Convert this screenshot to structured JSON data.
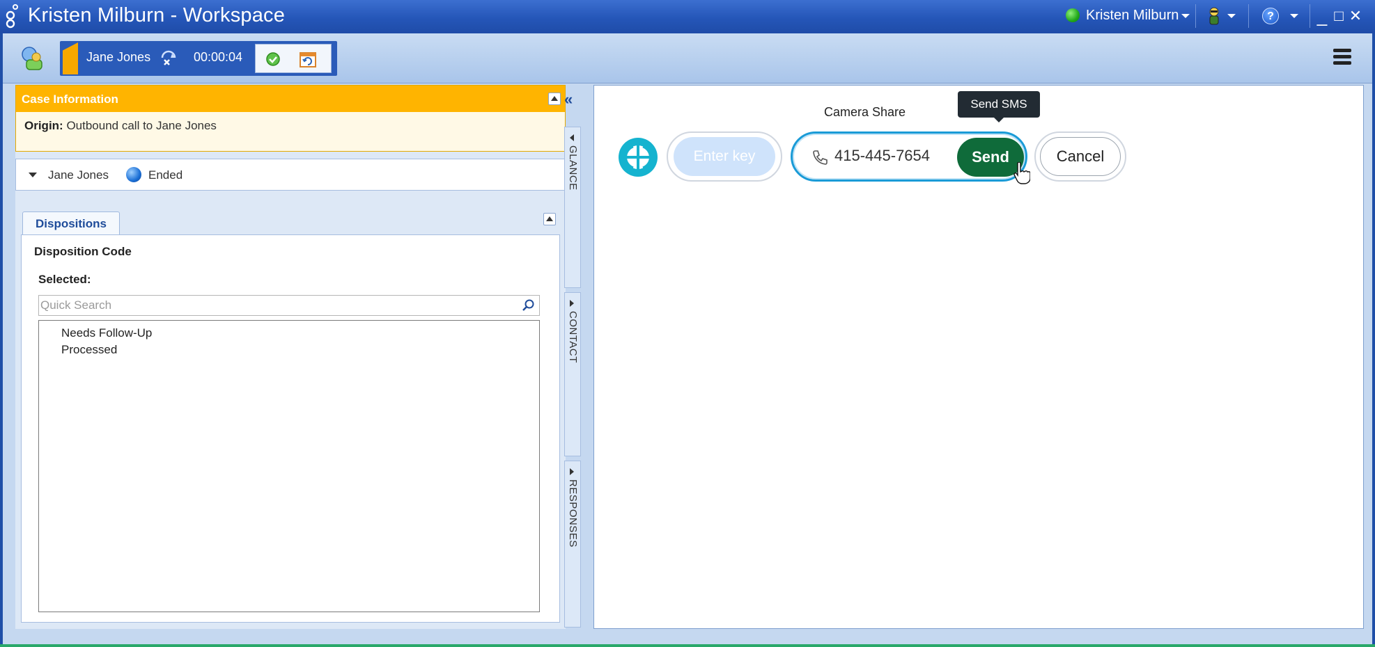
{
  "window": {
    "title": "Kristen Milburn - Workspace",
    "user_name": "Kristen Milburn",
    "status_color": "#22a81a",
    "help_glyph": "?",
    "minimize_glyph": "_",
    "maximize_glyph": "□",
    "close_glyph": "✕"
  },
  "callbar": {
    "contact_name": "Jane Jones",
    "timer": "00:00:04",
    "accent": "#f7a800"
  },
  "case_info": {
    "header": "Case Information",
    "origin_label": "Origin:",
    "origin_value": "Outbound call to Jane Jones"
  },
  "party": {
    "name": "Jane Jones",
    "state": "Ended"
  },
  "dispositions": {
    "tab_label": "Dispositions",
    "code_label": "Disposition Code",
    "selected_label": "Selected:",
    "search_placeholder": "Quick Search",
    "codes": [
      "Needs Follow-Up",
      "Processed"
    ]
  },
  "rail": {
    "collapse_glyph": "«",
    "tabs": [
      "GLANCE",
      "CONTACT",
      "RESPONSES"
    ]
  },
  "camera_share": {
    "title": "Camera Share",
    "tooltip": "Send SMS",
    "key_placeholder": "Enter key",
    "phone_number": "415-445-7654",
    "send_label": "Send",
    "cancel_label": "Cancel",
    "send_color": "#0f6b3a",
    "focus_color": "#1a9bd7"
  }
}
